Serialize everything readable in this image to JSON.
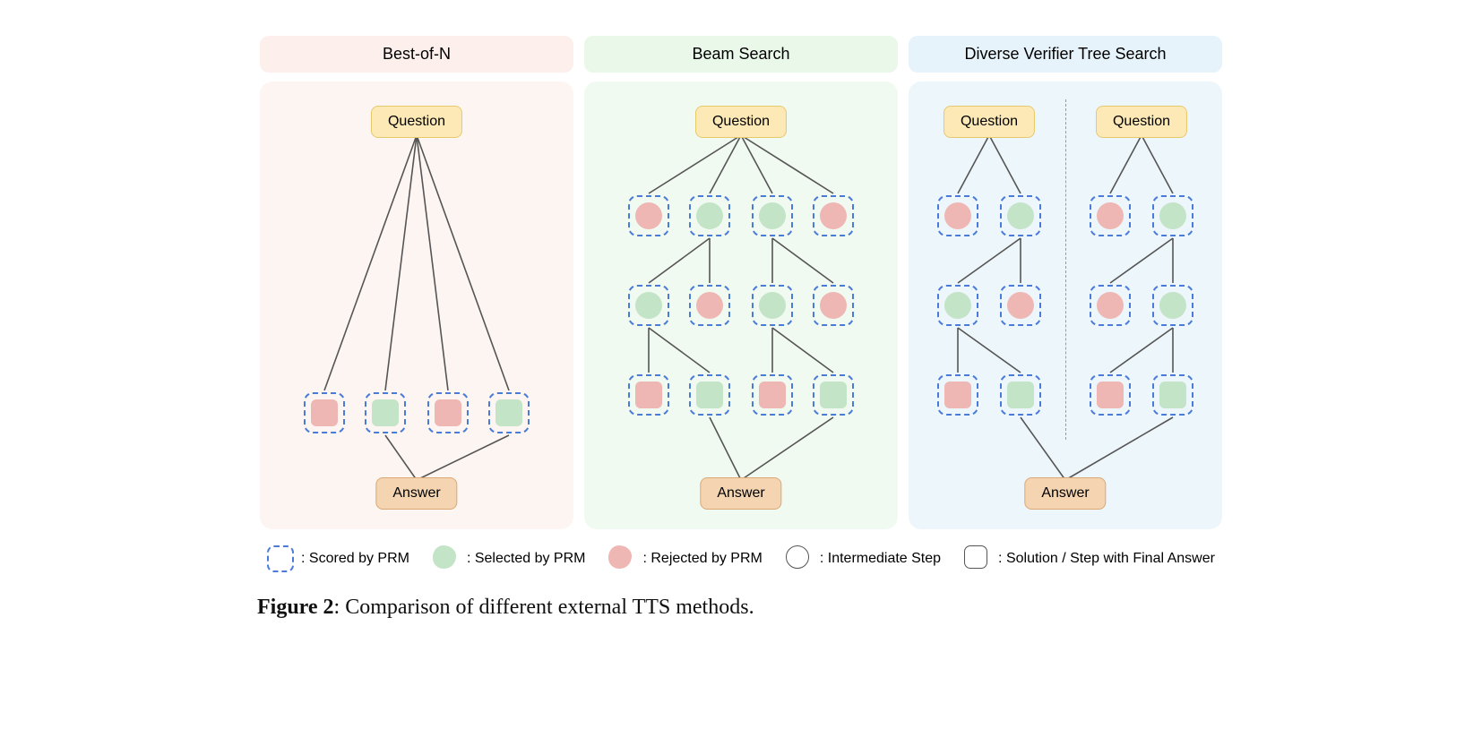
{
  "panels": {
    "best_of_n": {
      "title": "Best-of-N",
      "question": "Question",
      "answer": "Answer"
    },
    "beam_search": {
      "title": "Beam Search",
      "question": "Question",
      "answer": "Answer"
    },
    "dvts": {
      "title": "Diverse Verifier Tree Search",
      "question_left": "Question",
      "question_right": "Question",
      "answer": "Answer"
    }
  },
  "legend": {
    "scored": ": Scored by PRM",
    "selected": ": Selected by PRM",
    "rejected": ": Rejected by PRM",
    "intermediate": ": Intermediate Step",
    "solution": ": Solution / Step with Final Answer"
  },
  "caption_prefix": "Figure 2",
  "caption_body": ": Comparison of different external TTS methods.",
  "node_colors": {
    "selected": "green",
    "rejected": "red"
  },
  "diagram_structure": {
    "best_of_n": {
      "description": "Question fans out to 4 solutions scored by PRM; selected ones go to Answer.",
      "solutions": [
        "red",
        "green",
        "red",
        "green"
      ]
    },
    "beam_search": {
      "description": "Question expands tree; PRM scores each level; survivors expand; final selected go to Answer.",
      "level1": [
        "red",
        "green",
        "green",
        "red"
      ],
      "level2": [
        "green",
        "red",
        "green",
        "red"
      ],
      "level3": [
        "red",
        "green",
        "red",
        "green"
      ]
    },
    "dvts": {
      "description": "Two independent diverse subtrees each searched; selected leaves from both funnel into a single Answer.",
      "left": {
        "level1": [
          "red",
          "green"
        ],
        "level2": [
          "green",
          "red"
        ],
        "level3": [
          "red",
          "green"
        ]
      },
      "right": {
        "level1": [
          "red",
          "green"
        ],
        "level2": [
          "red",
          "green"
        ],
        "level3": [
          "red",
          "green"
        ]
      }
    }
  }
}
